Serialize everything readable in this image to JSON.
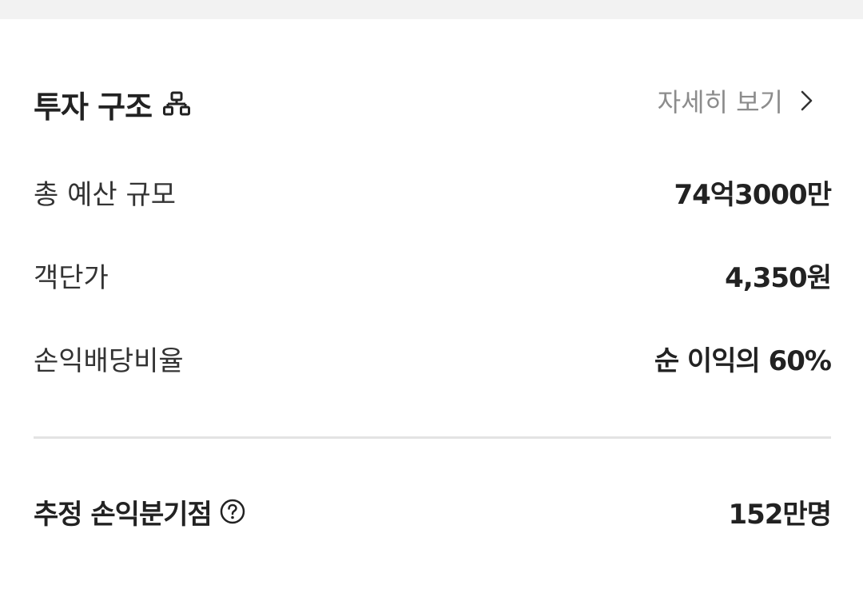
{
  "investment": {
    "title": "투자 구조",
    "title_icon": "org-chart-icon",
    "detail_link_label": "자세히 보기",
    "rows": [
      {
        "label": "총 예산 규모",
        "value": "74억3000만"
      },
      {
        "label": "객단가",
        "value": "4,350원"
      },
      {
        "label": "손익배당비율",
        "value": "순 이익의 60%"
      }
    ],
    "break_even": {
      "label": "추정 손익분기점",
      "value": "152만명",
      "help_icon": "question-circle-icon"
    }
  },
  "colors": {
    "text_primary": "#222222",
    "text_secondary": "#8c8c8c",
    "divider": "#e3e3e3",
    "top_strip": "#f2f2f2"
  }
}
